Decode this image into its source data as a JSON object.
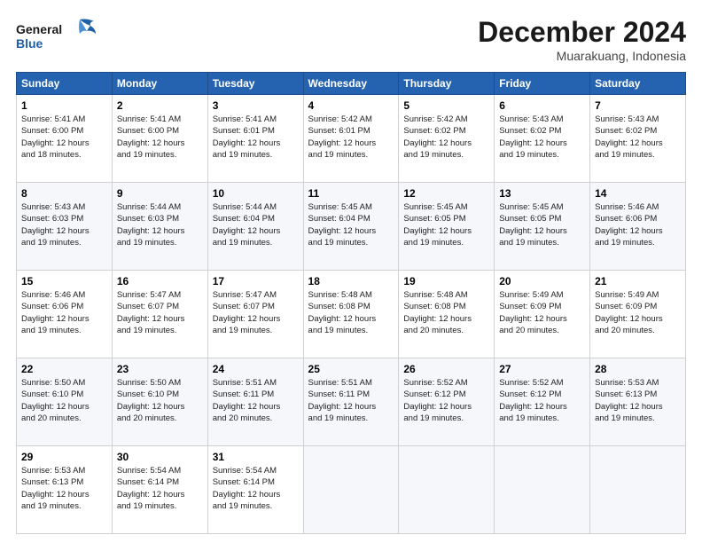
{
  "header": {
    "logo_general": "General",
    "logo_blue": "Blue",
    "month": "December 2024",
    "location": "Muarakuang, Indonesia"
  },
  "days_of_week": [
    "Sunday",
    "Monday",
    "Tuesday",
    "Wednesday",
    "Thursday",
    "Friday",
    "Saturday"
  ],
  "weeks": [
    [
      {
        "day": "1",
        "sunrise": "5:41 AM",
        "sunset": "6:00 PM",
        "daylight": "12 hours and 18 minutes."
      },
      {
        "day": "2",
        "sunrise": "5:41 AM",
        "sunset": "6:00 PM",
        "daylight": "12 hours and 19 minutes."
      },
      {
        "day": "3",
        "sunrise": "5:41 AM",
        "sunset": "6:01 PM",
        "daylight": "12 hours and 19 minutes."
      },
      {
        "day": "4",
        "sunrise": "5:42 AM",
        "sunset": "6:01 PM",
        "daylight": "12 hours and 19 minutes."
      },
      {
        "day": "5",
        "sunrise": "5:42 AM",
        "sunset": "6:02 PM",
        "daylight": "12 hours and 19 minutes."
      },
      {
        "day": "6",
        "sunrise": "5:43 AM",
        "sunset": "6:02 PM",
        "daylight": "12 hours and 19 minutes."
      },
      {
        "day": "7",
        "sunrise": "5:43 AM",
        "sunset": "6:02 PM",
        "daylight": "12 hours and 19 minutes."
      }
    ],
    [
      {
        "day": "8",
        "sunrise": "5:43 AM",
        "sunset": "6:03 PM",
        "daylight": "12 hours and 19 minutes."
      },
      {
        "day": "9",
        "sunrise": "5:44 AM",
        "sunset": "6:03 PM",
        "daylight": "12 hours and 19 minutes."
      },
      {
        "day": "10",
        "sunrise": "5:44 AM",
        "sunset": "6:04 PM",
        "daylight": "12 hours and 19 minutes."
      },
      {
        "day": "11",
        "sunrise": "5:45 AM",
        "sunset": "6:04 PM",
        "daylight": "12 hours and 19 minutes."
      },
      {
        "day": "12",
        "sunrise": "5:45 AM",
        "sunset": "6:05 PM",
        "daylight": "12 hours and 19 minutes."
      },
      {
        "day": "13",
        "sunrise": "5:45 AM",
        "sunset": "6:05 PM",
        "daylight": "12 hours and 19 minutes."
      },
      {
        "day": "14",
        "sunrise": "5:46 AM",
        "sunset": "6:06 PM",
        "daylight": "12 hours and 19 minutes."
      }
    ],
    [
      {
        "day": "15",
        "sunrise": "5:46 AM",
        "sunset": "6:06 PM",
        "daylight": "12 hours and 19 minutes."
      },
      {
        "day": "16",
        "sunrise": "5:47 AM",
        "sunset": "6:07 PM",
        "daylight": "12 hours and 19 minutes."
      },
      {
        "day": "17",
        "sunrise": "5:47 AM",
        "sunset": "6:07 PM",
        "daylight": "12 hours and 19 minutes."
      },
      {
        "day": "18",
        "sunrise": "5:48 AM",
        "sunset": "6:08 PM",
        "daylight": "12 hours and 19 minutes."
      },
      {
        "day": "19",
        "sunrise": "5:48 AM",
        "sunset": "6:08 PM",
        "daylight": "12 hours and 20 minutes."
      },
      {
        "day": "20",
        "sunrise": "5:49 AM",
        "sunset": "6:09 PM",
        "daylight": "12 hours and 20 minutes."
      },
      {
        "day": "21",
        "sunrise": "5:49 AM",
        "sunset": "6:09 PM",
        "daylight": "12 hours and 20 minutes."
      }
    ],
    [
      {
        "day": "22",
        "sunrise": "5:50 AM",
        "sunset": "6:10 PM",
        "daylight": "12 hours and 20 minutes."
      },
      {
        "day": "23",
        "sunrise": "5:50 AM",
        "sunset": "6:10 PM",
        "daylight": "12 hours and 20 minutes."
      },
      {
        "day": "24",
        "sunrise": "5:51 AM",
        "sunset": "6:11 PM",
        "daylight": "12 hours and 20 minutes."
      },
      {
        "day": "25",
        "sunrise": "5:51 AM",
        "sunset": "6:11 PM",
        "daylight": "12 hours and 19 minutes."
      },
      {
        "day": "26",
        "sunrise": "5:52 AM",
        "sunset": "6:12 PM",
        "daylight": "12 hours and 19 minutes."
      },
      {
        "day": "27",
        "sunrise": "5:52 AM",
        "sunset": "6:12 PM",
        "daylight": "12 hours and 19 minutes."
      },
      {
        "day": "28",
        "sunrise": "5:53 AM",
        "sunset": "6:13 PM",
        "daylight": "12 hours and 19 minutes."
      }
    ],
    [
      {
        "day": "29",
        "sunrise": "5:53 AM",
        "sunset": "6:13 PM",
        "daylight": "12 hours and 19 minutes."
      },
      {
        "day": "30",
        "sunrise": "5:54 AM",
        "sunset": "6:14 PM",
        "daylight": "12 hours and 19 minutes."
      },
      {
        "day": "31",
        "sunrise": "5:54 AM",
        "sunset": "6:14 PM",
        "daylight": "12 hours and 19 minutes."
      },
      null,
      null,
      null,
      null
    ]
  ],
  "labels": {
    "sunrise": "Sunrise:",
    "sunset": "Sunset:",
    "daylight": "Daylight:"
  }
}
